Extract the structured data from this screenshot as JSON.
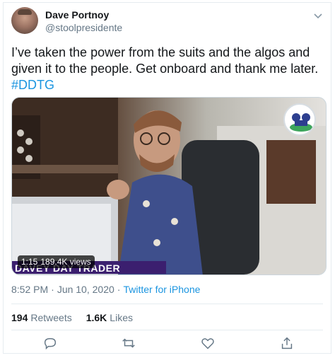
{
  "author": {
    "name": "Dave Portnoy",
    "handle": "@stoolpresidente"
  },
  "tweet": {
    "text": "I’ve taken the power from the suits and the algos and given it to the people. Get onboard and thank me later.",
    "hashtag": "#DDTG"
  },
  "media": {
    "banner_text": "DAVEY DAY TRADER GLOBAL",
    "duration": "1:15",
    "views": "189.4K views"
  },
  "meta": {
    "time": "8:52 PM",
    "separator": "·",
    "date": "Jun 10, 2020",
    "source": "Twitter for iPhone"
  },
  "stats": {
    "retweets_count": "194",
    "retweets_label": "Retweets",
    "likes_count": "1.6K",
    "likes_label": "Likes"
  },
  "icons": {
    "menu": "chevron-down-icon",
    "reply": "reply-icon",
    "retweet": "retweet-icon",
    "like": "heart-icon",
    "share": "share-icon"
  },
  "colors": {
    "link": "#1b95e0",
    "secondary_text": "#657786",
    "banner": "#3b1f6f"
  }
}
